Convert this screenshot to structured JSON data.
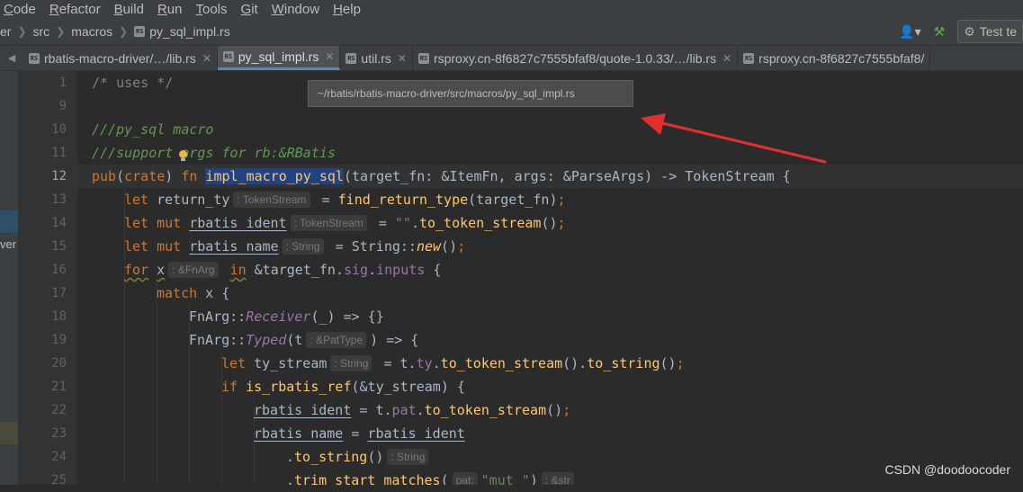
{
  "menu": [
    "Code",
    "Refactor",
    "Build",
    "Run",
    "Tools",
    "Git",
    "Window",
    "Help"
  ],
  "menu_mnemonics": [
    "C",
    "R",
    "B",
    "R",
    "T",
    "G",
    "W",
    "H"
  ],
  "breadcrumb": [
    "er",
    "src",
    "macros",
    "py_sql_impl.rs"
  ],
  "toolbar": {
    "run_config": "Test te"
  },
  "tabs": [
    {
      "label": "rbatis-macro-driver/…/lib.rs",
      "active": false
    },
    {
      "label": "py_sql_impl.rs",
      "active": true
    },
    {
      "label": "util.rs",
      "active": false
    },
    {
      "label": "rsproxy.cn-8f6827c7555bfaf8/quote-1.0.33/…/lib.rs",
      "active": false
    },
    {
      "label": "rsproxy.cn-8f6827c7555bfaf8/",
      "active": false
    }
  ],
  "tooltip": "~/rbatis/rbatis-macro-driver/src/macros/py_sql_impl.rs",
  "left_strip_text": "ver",
  "line_numbers": [
    "1",
    "9",
    "10",
    "11",
    "12",
    "13",
    "14",
    "15",
    "16",
    "17",
    "18",
    "19",
    "20",
    "21",
    "22",
    "23",
    "24",
    "25"
  ],
  "current_line": "12",
  "type_hints": {
    "return_ty": ": TokenStream",
    "rbatis_ident": ": TokenStream",
    "rbatis_name": ": String",
    "x": ": &FnArg",
    "pat_type": ": &PatType",
    "ty_stream": ": String",
    "to_string": ": String",
    "pat_param": "pat:",
    "str_ret": ": &str"
  },
  "watermark": "CSDN @doodoocoder",
  "colors": {
    "background": "#2b2b2b",
    "keyword": "#cc7832",
    "function": "#ffc66d",
    "doc_comment": "#629755",
    "string": "#6a8759",
    "selection": "#214283",
    "active_tab_underline": "#4a88c7",
    "arrow": "#e03030"
  }
}
